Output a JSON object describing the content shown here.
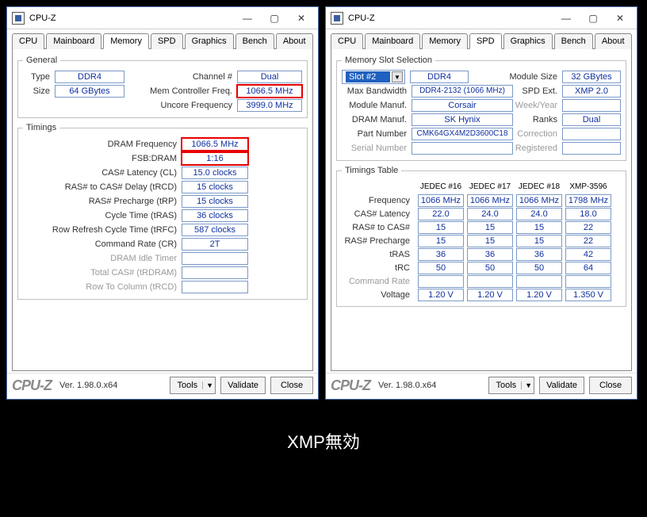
{
  "caption": "XMP無効",
  "windows": {
    "left": {
      "title": "CPU-Z",
      "tabs": [
        "CPU",
        "Mainboard",
        "Memory",
        "SPD",
        "Graphics",
        "Bench",
        "About"
      ],
      "active_tab": "Memory",
      "footer": {
        "brand": "CPU-Z",
        "version": "Ver. 1.98.0.x64",
        "tools": "Tools",
        "validate": "Validate",
        "close": "Close"
      },
      "general": {
        "legend": "General",
        "type_label": "Type",
        "type": "DDR4",
        "size_label": "Size",
        "size": "64 GBytes",
        "channel_label": "Channel #",
        "channel": "Dual",
        "mcf_label": "Mem Controller Freq.",
        "mcf": "1066.5 MHz",
        "uncore_label": "Uncore Frequency",
        "uncore": "3999.0 MHz"
      },
      "timings": {
        "legend": "Timings",
        "dram_freq_label": "DRAM Frequency",
        "dram_freq": "1066.5 MHz",
        "fsb_dram_label": "FSB:DRAM",
        "fsb_dram": "1:16",
        "cl_label": "CAS# Latency (CL)",
        "cl": "15.0 clocks",
        "trcd_label": "RAS# to CAS# Delay (tRCD)",
        "trcd": "15 clocks",
        "trp_label": "RAS# Precharge (tRP)",
        "trp": "15 clocks",
        "tras_label": "Cycle Time (tRAS)",
        "tras": "36 clocks",
        "trfc_label": "Row Refresh Cycle Time (tRFC)",
        "trfc": "587 clocks",
        "cr_label": "Command Rate (CR)",
        "cr": "2T",
        "idle_label": "DRAM Idle Timer",
        "total_cas_label": "Total CAS# (tRDRAM)",
        "rtc_label": "Row To Column (tRCD)"
      }
    },
    "right": {
      "title": "CPU-Z",
      "tabs": [
        "CPU",
        "Mainboard",
        "Memory",
        "SPD",
        "Graphics",
        "Bench",
        "About"
      ],
      "active_tab": "SPD",
      "footer": {
        "brand": "CPU-Z",
        "version": "Ver. 1.98.0.x64",
        "tools": "Tools",
        "validate": "Validate",
        "close": "Close"
      },
      "slot": {
        "legend": "Memory Slot Selection",
        "selected": "Slot #2",
        "type": "DDR4",
        "maxbw_label": "Max Bandwidth",
        "maxbw": "DDR4-2132 (1066 MHz)",
        "mfr_label": "Module Manuf.",
        "mfr": "Corsair",
        "dram_mfr_label": "DRAM Manuf.",
        "dram_mfr": "SK Hynix",
        "part_label": "Part Number",
        "part": "CMK64GX4M2D3600C18",
        "serial_label": "Serial Number",
        "modsize_label": "Module Size",
        "modsize": "32 GBytes",
        "spdext_label": "SPD Ext.",
        "spdext": "XMP 2.0",
        "week_label": "Week/Year",
        "ranks_label": "Ranks",
        "ranks": "Dual",
        "correction_label": "Correction",
        "registered_label": "Registered"
      },
      "timings_table": {
        "legend": "Timings Table",
        "columns": [
          "JEDEC #16",
          "JEDEC #17",
          "JEDEC #18",
          "XMP-3596"
        ],
        "rows": [
          {
            "label": "Frequency",
            "v": [
              "1066 MHz",
              "1066 MHz",
              "1066 MHz",
              "1798 MHz"
            ]
          },
          {
            "label": "CAS# Latency",
            "v": [
              "22.0",
              "24.0",
              "24.0",
              "18.0"
            ]
          },
          {
            "label": "RAS# to CAS#",
            "v": [
              "15",
              "15",
              "15",
              "22"
            ]
          },
          {
            "label": "RAS# Precharge",
            "v": [
              "15",
              "15",
              "15",
              "22"
            ]
          },
          {
            "label": "tRAS",
            "v": [
              "36",
              "36",
              "36",
              "42"
            ]
          },
          {
            "label": "tRC",
            "v": [
              "50",
              "50",
              "50",
              "64"
            ]
          },
          {
            "label": "Command Rate",
            "v": [
              "",
              "",
              "",
              ""
            ]
          },
          {
            "label": "Voltage",
            "v": [
              "1.20 V",
              "1.20 V",
              "1.20 V",
              "1.350 V"
            ]
          }
        ]
      }
    }
  }
}
